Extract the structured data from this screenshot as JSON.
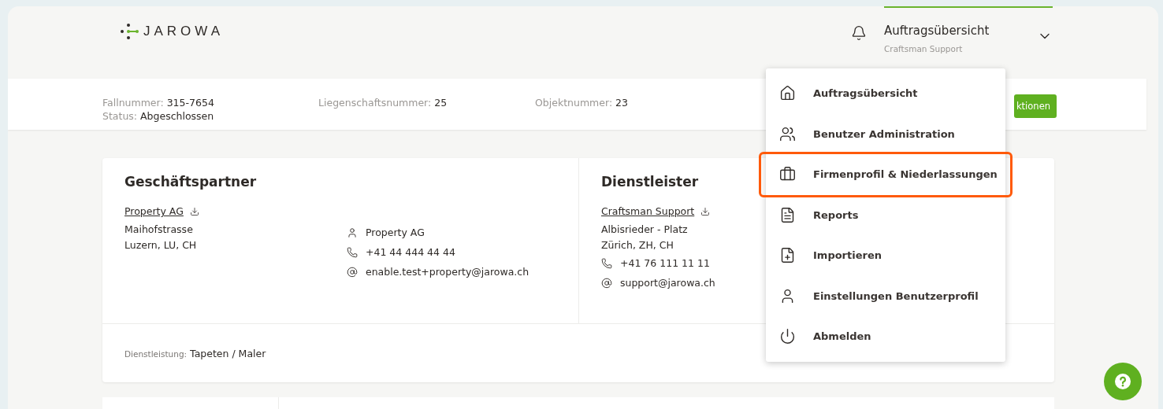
{
  "logo": {
    "text": "JAROWA"
  },
  "header": {
    "nav_title": "Auftragsübersicht",
    "nav_subtitle": "Craftsman Support",
    "expanded": true
  },
  "case_info": [
    {
      "label": "Fallnummer:",
      "value": "315-7654"
    },
    {
      "label": "Status:",
      "value": "Abgeschlossen"
    },
    {
      "label": "Liegenschaftsnummer:",
      "value": "25"
    },
    {
      "label": "Objektnummer:",
      "value": "23"
    }
  ],
  "actions_button": {
    "label": "ktionen"
  },
  "business_partner": {
    "title": "Geschäftspartner",
    "name": "Property AG",
    "address": [
      "Maihofstrasse",
      "Luzern, LU, CH"
    ],
    "contact_person": "Property AG",
    "phone": "+41 44 444 44 44",
    "email": "enable.test+property@jarowa.ch"
  },
  "service_provider": {
    "title": "Dienstleister",
    "name": "Craftsman Support",
    "address": [
      "Albisrieder - Platz",
      "Zürich, ZH, CH"
    ],
    "phone": "+41 76 111 11 11",
    "email": "support@jarowa.ch"
  },
  "service": {
    "label": "Dienstleistung:",
    "value": "Tapeten / Maler"
  },
  "menu": [
    {
      "label": "Auftragsübersicht",
      "highlighted": false
    },
    {
      "label": "Benutzer Administration",
      "highlighted": false
    },
    {
      "label": "Firmenprofil & Niederlassungen",
      "highlighted": true
    },
    {
      "label": "Reports",
      "highlighted": false
    },
    {
      "label": "Importieren",
      "highlighted": false
    },
    {
      "label": "Einstellungen Benutzerprofil",
      "highlighted": false
    },
    {
      "label": "Abmelden",
      "highlighted": false
    }
  ]
}
